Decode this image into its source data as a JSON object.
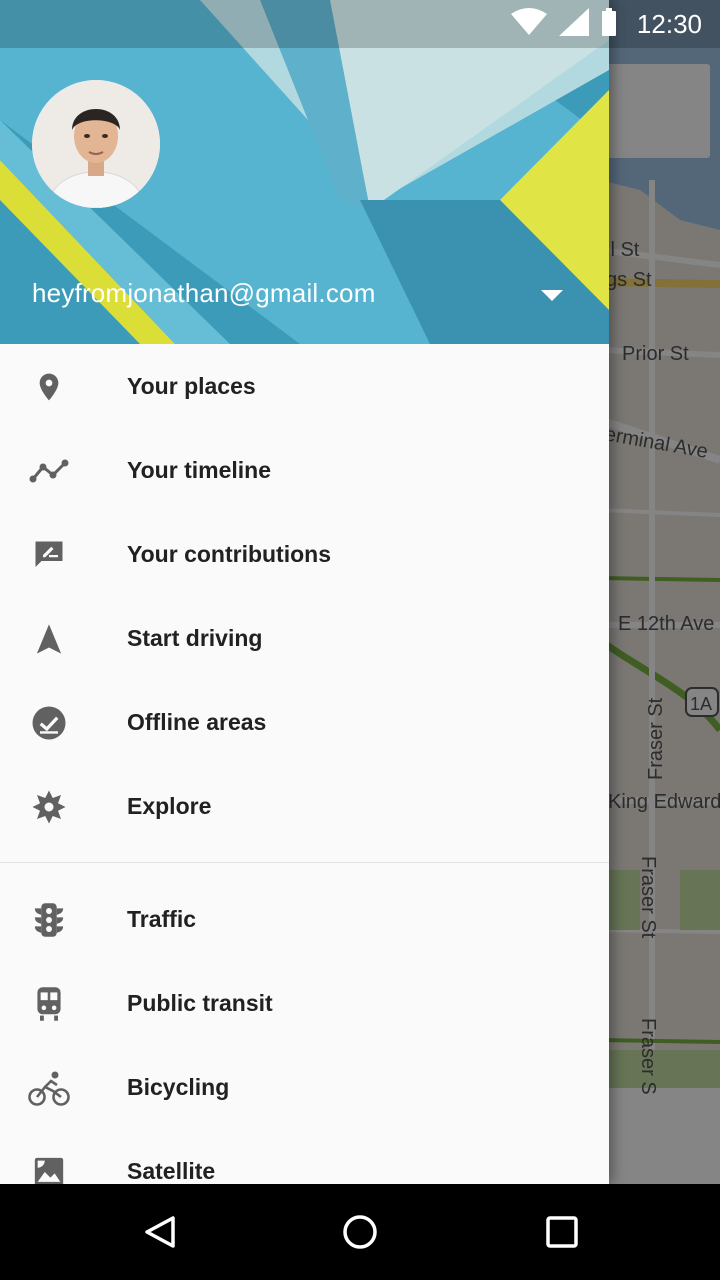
{
  "status_bar": {
    "time": "12:30",
    "icons": [
      "wifi-icon",
      "cell-signal-icon",
      "battery-icon"
    ]
  },
  "drawer": {
    "account": {
      "email": "heyfromjonathan@gmail.com"
    },
    "primary_items": [
      {
        "label": "Your places",
        "icon": "place-pin-icon"
      },
      {
        "label": "Your timeline",
        "icon": "timeline-icon"
      },
      {
        "label": "Your contributions",
        "icon": "contributions-icon"
      },
      {
        "label": "Start driving",
        "icon": "navigation-arrow-icon"
      },
      {
        "label": "Offline areas",
        "icon": "offline-check-icon"
      },
      {
        "label": "Explore",
        "icon": "explore-icon"
      }
    ],
    "layer_items": [
      {
        "label": "Traffic",
        "icon": "traffic-light-icon"
      },
      {
        "label": "Public transit",
        "icon": "transit-train-icon"
      },
      {
        "label": "Bicycling",
        "icon": "bicycle-icon"
      },
      {
        "label": "Satellite",
        "icon": "satellite-icon"
      }
    ]
  },
  "map": {
    "street_labels": [
      "ll St",
      "gs St",
      "Prior St",
      "erminal Ave",
      "E 12th Ave",
      "1A",
      "Fraser St",
      "King Edward",
      "Fraser St",
      "Fraser S"
    ]
  },
  "colors": {
    "drawer_background": "#fafafa",
    "header_blue": "#4fb6d6",
    "header_yellow": "#eef34a",
    "icon_gray": "#616161",
    "text_primary": "#212121"
  }
}
